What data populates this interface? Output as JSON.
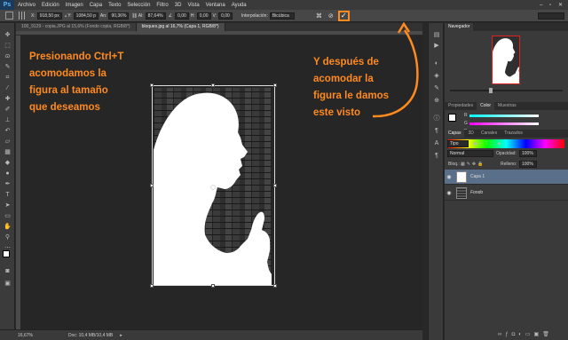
{
  "app": {
    "logo": "Ps"
  },
  "menu": [
    "Archivo",
    "Edición",
    "Imagen",
    "Capa",
    "Texto",
    "Selección",
    "Filtro",
    "3D",
    "Vista",
    "Ventana",
    "Ayuda"
  ],
  "options": {
    "x_label": "X:",
    "x_value": "918,50 px",
    "y_label": "Y:",
    "y_value": "1084,50 p",
    "w_label": "An:",
    "w_value": "90,36%",
    "h_label": "Al:",
    "h_value": "87,64%",
    "angle_value": "0,00",
    "h2_label": "H:",
    "h2_value": "0,00",
    "v_label": "V:",
    "v_value": "0,00",
    "interp_label": "Interpolación:",
    "interp_value": "Bicúbica"
  },
  "tabs": [
    {
      "label": "100_9129 - copia.JPG al 15,6% (Fondo copia, RGB/8*)",
      "active": false
    },
    {
      "label": "bloques.jpg al 16,7% (Capa 1, RGB/8*)",
      "active": true
    }
  ],
  "annotations": {
    "left": [
      "Presionando Ctrl+T",
      "acomodamos la",
      "figura al tamaño",
      "que deseamos"
    ],
    "right": [
      "Y después de",
      "acomodar la",
      "figura le damos",
      "este visto"
    ]
  },
  "status": {
    "zoom": "16,67%",
    "doc": "Doc: 10,4 MB/10,4 MB"
  },
  "navigator": {
    "title": "Navegador"
  },
  "color_panel": {
    "tabs": [
      "Propiedades",
      "Color",
      "Muestras"
    ],
    "labels": [
      "R",
      "G",
      "B"
    ]
  },
  "layers_panel": {
    "tabs": [
      "Capas",
      "3D",
      "Canales",
      "Trazados"
    ],
    "filter_label": "Tipo",
    "blend_mode": "Normal",
    "opacity_label": "Opacidad:",
    "opacity_value": "100%",
    "lock_label": "Bloq.:",
    "fill_label": "Relleno:",
    "fill_value": "100%",
    "layers": [
      {
        "name": "Capa 1",
        "selected": true
      },
      {
        "name": "Fondo",
        "selected": false
      }
    ]
  },
  "colors": {
    "accent": "#ff8a1f",
    "selection": "#5a6f89"
  }
}
